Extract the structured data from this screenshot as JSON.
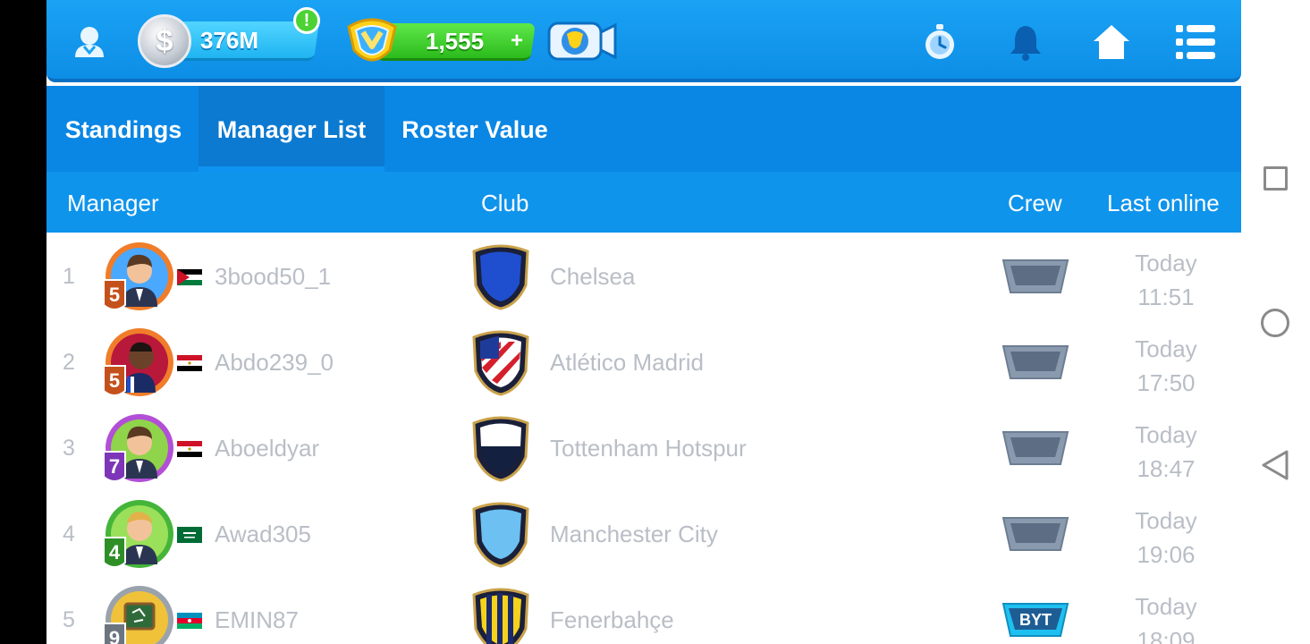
{
  "topbar": {
    "coins": "376M",
    "coin_symbol": "$",
    "coin_alert": "!",
    "gems": "1,555",
    "gem_plus": "+"
  },
  "tabs": [
    {
      "label": "Standings",
      "active": false
    },
    {
      "label": "Manager List",
      "active": true
    },
    {
      "label": "Roster Value",
      "active": false
    }
  ],
  "columns": {
    "manager": "Manager",
    "club": "Club",
    "crew": "Crew",
    "last_online": "Last online"
  },
  "rows": [
    {
      "rank": "1",
      "level": "5",
      "flag": "Jordan",
      "manager": "3bood50_1",
      "club": "Chelsea",
      "crew": "",
      "last_day": "Today",
      "last_time": "11:51"
    },
    {
      "rank": "2",
      "level": "5",
      "flag": "Egypt",
      "manager": "Abdo239_0",
      "club": "Atlético Madrid",
      "crew": "",
      "last_day": "Today",
      "last_time": "17:50"
    },
    {
      "rank": "3",
      "level": "7",
      "flag": "Egypt",
      "manager": "Aboeldyar",
      "club": "Tottenham Hotspur",
      "crew": "",
      "last_day": "Today",
      "last_time": "18:47"
    },
    {
      "rank": "4",
      "level": "4",
      "flag": "Saudi Arabia",
      "manager": "Awad305",
      "club": "Manchester City",
      "crew": "",
      "last_day": "Today",
      "last_time": "19:06"
    },
    {
      "rank": "5",
      "level": "9",
      "flag": "Azerbaijan",
      "manager": "EMIN87",
      "club": "Fenerbahçe",
      "crew": "BYT",
      "last_day": "Today",
      "last_time": "18:09"
    }
  ],
  "colors": {
    "topbar": "#1aa2f4",
    "tabs": "#0a86e4",
    "header": "#0f94ec",
    "row_text": "#b9bec6",
    "gem_pill": "#2cbb1c",
    "coin_pill": "#1fb4f2"
  },
  "icons": [
    "profile-icon",
    "coin-icon",
    "gem-icon",
    "video-icon",
    "stopwatch-icon",
    "bell-icon",
    "home-icon",
    "menu-icon",
    "square-nav-icon",
    "circle-nav-icon",
    "back-nav-icon"
  ]
}
